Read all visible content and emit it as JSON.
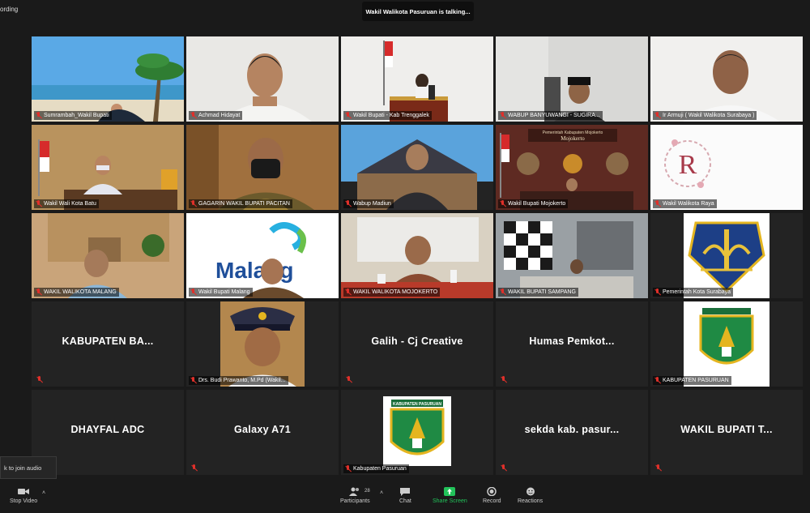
{
  "meeting": {
    "recording_text": "ording",
    "talking_banner": "Wakil Walikota Pasuruan is talking..."
  },
  "tiles": [
    {
      "label": "Sumrambah_Wakil Bupati",
      "type": "video"
    },
    {
      "label": "Achmad Hidayat",
      "type": "video"
    },
    {
      "label": "Wakil Bupati - Kab Trenggalek",
      "type": "video"
    },
    {
      "label": "WABUP BANYUWANGI - SUGIRA...",
      "type": "video"
    },
    {
      "label": "Ir Armuji ( Wakil Walikota Surabaya )",
      "type": "video"
    },
    {
      "label": "Wakil Wali Kota Batu",
      "type": "video"
    },
    {
      "label": "GAGARIN WAKIL BUPATI PACITAN",
      "type": "video"
    },
    {
      "label": "Wabup Madiun",
      "type": "video"
    },
    {
      "label": "Wakil Bupati Mojokerto",
      "type": "video"
    },
    {
      "label": "Wakil Walikota Raya",
      "type": "video"
    },
    {
      "label": "WAKIL WALIKOTA MALANG",
      "type": "video"
    },
    {
      "label": "Wakil Bupati Malang",
      "type": "video"
    },
    {
      "label": "WAKIL WALIKOTA MOJOKERTO",
      "type": "video"
    },
    {
      "label": "WAKIL BUPATI SAMPANG",
      "type": "video"
    },
    {
      "label": "Pemerintah Kota Surabaya",
      "type": "video"
    },
    {
      "name": "KABUPATEN BA...",
      "type": "name"
    },
    {
      "label": "Drs. Budi Prawanto, M.Pd (Wakil...",
      "type": "video"
    },
    {
      "name": "Galih - Cj Creative",
      "type": "name"
    },
    {
      "name": "Humas Pemkot...",
      "type": "name"
    },
    {
      "label": "KABUPATEN PASURUAN",
      "type": "video"
    },
    {
      "name": "DHAYFAL ADC",
      "type": "name"
    },
    {
      "name": "Galaxy A71",
      "type": "name"
    },
    {
      "label": "Kabupaten Pasuruan",
      "type": "video"
    },
    {
      "name": "sekda kab. pasur...",
      "type": "name"
    },
    {
      "name": "WAKIL BUPATI T...",
      "type": "name"
    }
  ],
  "logos": {
    "malang_text": "Malang",
    "mojokerto_banner": "Pemerintah Kabupaten Mojokerto",
    "mojokerto_sign": "Mojokerto",
    "pasuruan_banner": "KABUPATEN PASURUAN"
  },
  "audio_popup": "k to join audio",
  "toolbar": {
    "stop_video": "Stop Video",
    "participants": "Participants",
    "participants_count": "28",
    "chat": "Chat",
    "share_screen": "Share Screen",
    "record": "Record",
    "reactions": "Reactions"
  },
  "colors": {
    "share_green": "#22c35a",
    "muted_red": "#e0302a"
  }
}
